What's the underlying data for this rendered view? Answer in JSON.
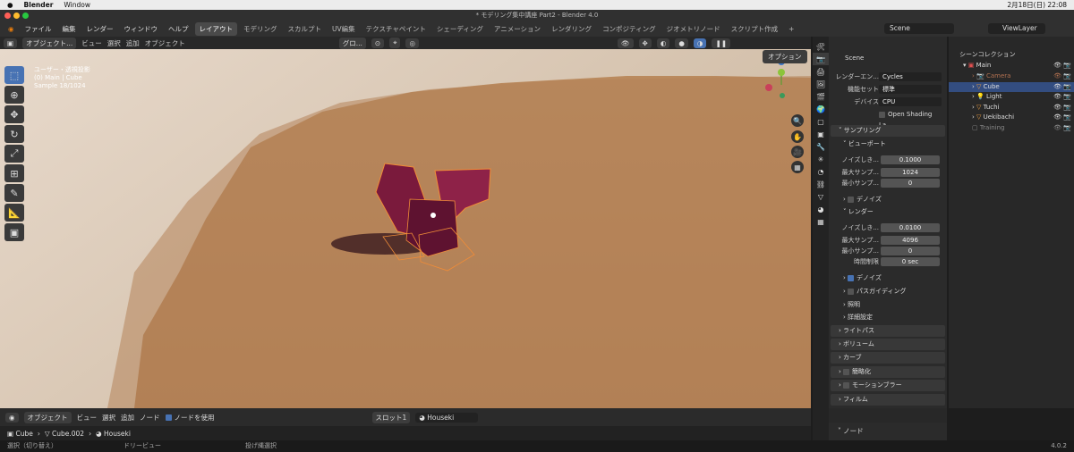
{
  "mac": {
    "app": "Blender",
    "window": "Window",
    "datetime": "2月18日(日)  22:08"
  },
  "title": "* モデリング集中講座 Part2 - Blender 4.0",
  "menu": [
    "ファイル",
    "編集",
    "レンダー",
    "ウィンドウ",
    "ヘルプ"
  ],
  "workspaces": [
    "レイアウト",
    "モデリング",
    "スカルプト",
    "UV編集",
    "テクスチャペイント",
    "シェーディング",
    "アニメーション",
    "レンダリング",
    "コンポジティング",
    "ジオメトリノード",
    "スクリプト作成"
  ],
  "scene_name": "Scene",
  "viewlayer_name": "ViewLayer",
  "viewport": {
    "mode": "オブジェクト...",
    "menus": [
      "ビュー",
      "選択",
      "追加",
      "オブジェクト"
    ],
    "transform": "グロ...",
    "info_lines": [
      "ユーザー・透視投影",
      "(0) Main | Cube",
      "Sample 18/1024"
    ],
    "options": "オプション"
  },
  "props": {
    "scene": "Scene",
    "engine_label": "レンダーエン...",
    "engine": "Cycles",
    "featureset_label": "機能セット",
    "featureset": "標準",
    "device_label": "デバイス",
    "device": "CPU",
    "osl": "Open Shading La...",
    "sampling": "サンプリング",
    "viewport_panel": "ビューポート",
    "noise_label": "ノイズしき...",
    "vp_noise": "0.1000",
    "max_label": "最大サンプ...",
    "vp_max": "1024",
    "min_label": "最小サンプ...",
    "vp_min": "0",
    "denoise": "デノイズ",
    "render_panel": "レンダー",
    "r_noise": "0.0100",
    "r_max": "4096",
    "r_min": "0",
    "time_label": "時間制限",
    "r_time": "0 sec",
    "r_denoise": "デノイズ",
    "path_guiding": "パスガイディング",
    "lights": "照明",
    "advanced": "詳細設定",
    "panels": [
      "ライトパス",
      "ボリューム",
      "カーブ",
      "簡略化",
      "モーションブラー",
      "フィルム"
    ]
  },
  "outliner": {
    "collection": "シーンコレクション",
    "main": "Main",
    "items": [
      "Camera",
      "Cube",
      "Light",
      "Tuchi",
      "Uekibachi"
    ],
    "training": "Training"
  },
  "node": {
    "mode": "オブジェクト",
    "menus": [
      "ビュー",
      "選択",
      "追加",
      "ノード"
    ],
    "use_nodes": "ノードを使用",
    "slot": "スロット1",
    "material": "Houseki"
  },
  "breadcrumb": [
    "Cube",
    "Cube.002",
    "Houseki"
  ],
  "node_panel": "ノード",
  "status": {
    "select": "選択（切り替え）",
    "dolly": "ドリービュー",
    "lasso": "投げ縄選択",
    "version": "4.0.2"
  }
}
